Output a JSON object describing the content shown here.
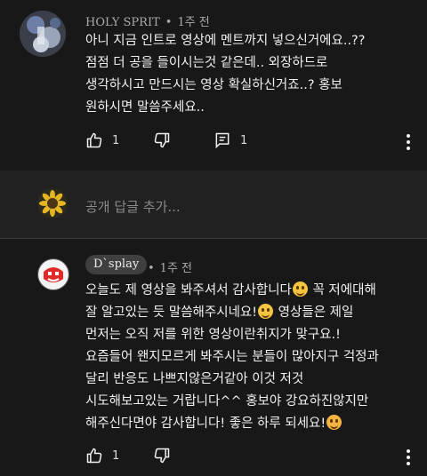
{
  "comment1": {
    "author": "HOLY SPRIT",
    "separator": "•",
    "time": "1주 전",
    "lines": [
      "아니 지금 인트로 영상에 멘트까지 넣으신거에요..??",
      "점점 더 공을 들이시는것 같은데.. 외장하드로",
      "생각하시고 만드시는 영상 확실하신거죠..? 홍보",
      "원하시면 말씀주세요.."
    ],
    "likes": "1",
    "replies": "1",
    "icons": [
      "like-icon",
      "dislike-icon",
      "reply-icon",
      "more-vert-icon"
    ]
  },
  "reply_box": {
    "placeholder": "공개 답글 추가..."
  },
  "comment2": {
    "author": "D`splay",
    "separator": "•",
    "time": "1주 전",
    "lines": [
      [
        "오늘도 제 영상을 봐주셔서 감사합니다",
        "smile",
        " 꼭 저에대해"
      ],
      [
        "잘 알고있는 듯 말씀해주시네요!",
        "grin",
        " 영상들은 제일"
      ],
      [
        "먼저는 오직 저를 위한 영상이란취지가 맞구요.!"
      ],
      [
        "요즘들어 왠지모르게 봐주시는 분들이 많아지구 걱정과"
      ],
      [
        "달리 반응도 나쁘지않은거같아 이것 저것"
      ],
      [
        "시도해보고있는 거랍니다^^ 홍보야 강요하진않지만"
      ],
      [
        "해주신다면야 감사합니다! 좋은 하루 되세요!",
        "hug",
        ""
      ]
    ],
    "likes": "1",
    "icons": [
      "like-icon",
      "dislike-icon",
      "more-vert-icon"
    ]
  },
  "colors": {
    "background": "#181818",
    "reply_section": "#212121",
    "text": "#f1f1f1",
    "meta": "#aaaaaa"
  }
}
